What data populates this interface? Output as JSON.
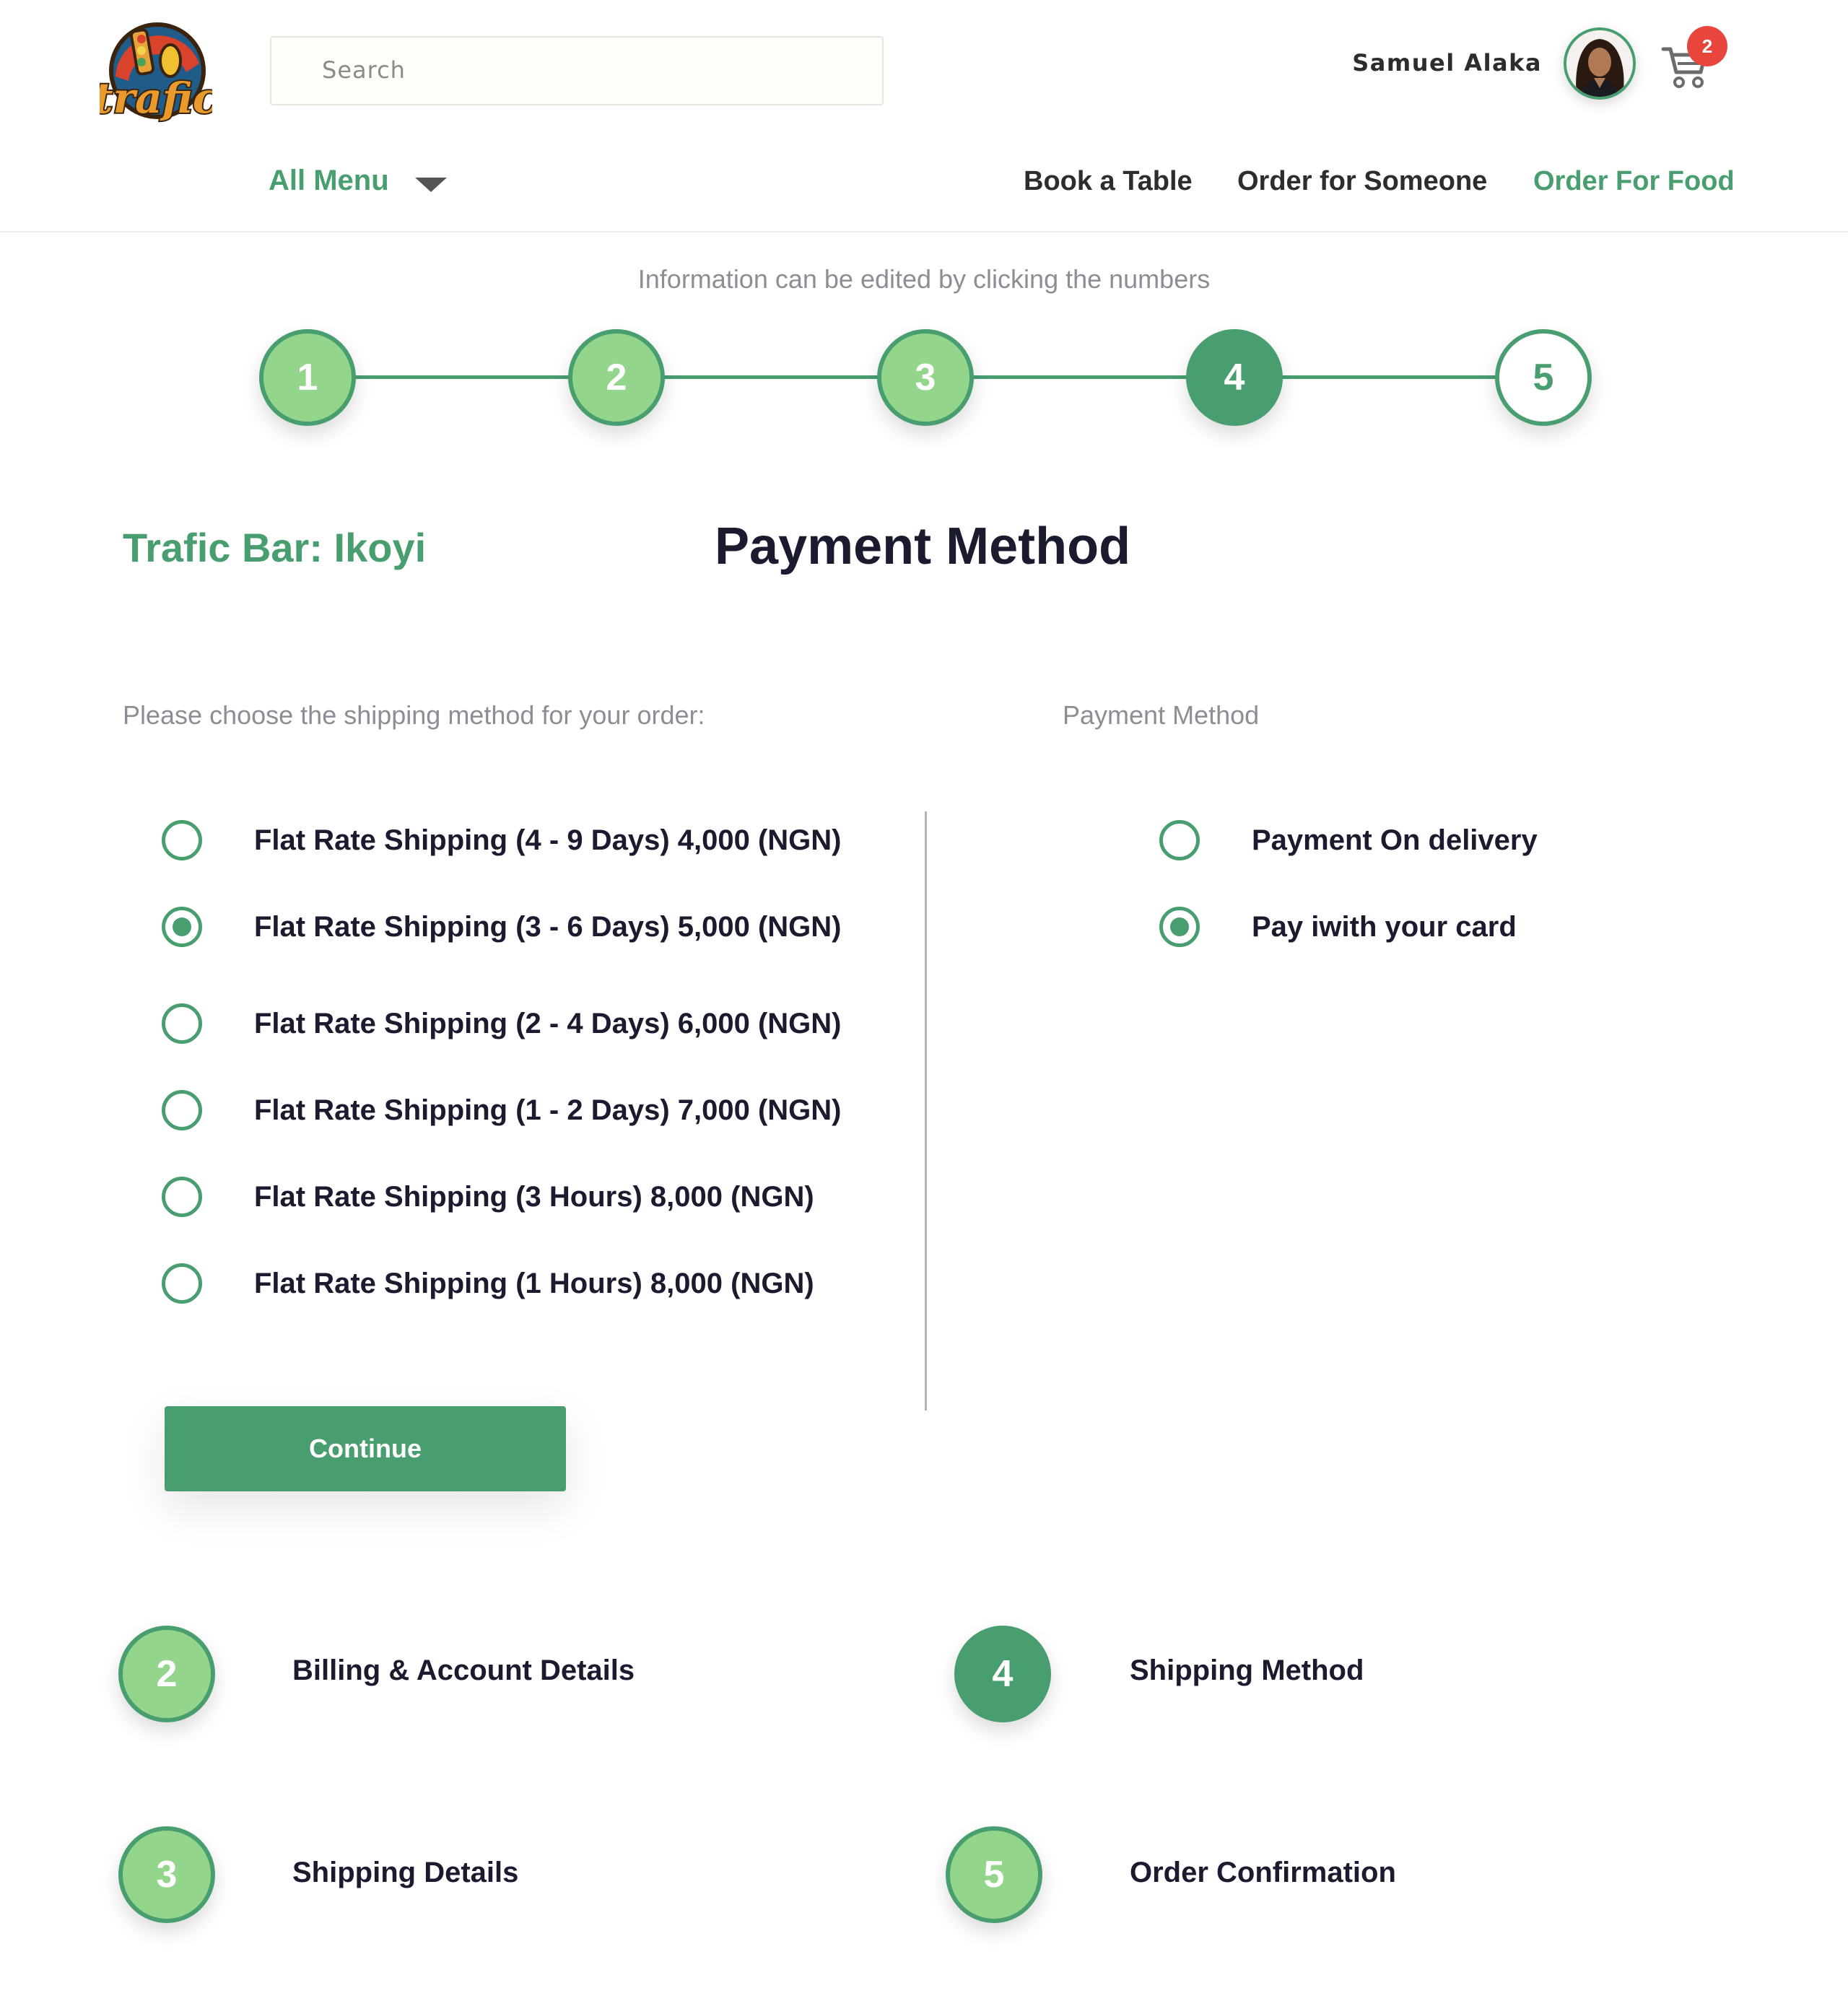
{
  "header": {
    "logo_text": "trafic",
    "search_placeholder": "Search",
    "user_name": "Samuel Alaka",
    "cart_count": "2"
  },
  "nav": {
    "all_menu": "All Menu",
    "links": [
      "Book a Table",
      "Order for Someone",
      "Order For Food"
    ],
    "active_link": "Order For Food"
  },
  "stepper": {
    "hint": "Information can be edited by clicking the numbers",
    "steps": [
      "1",
      "2",
      "3",
      "4",
      "5"
    ],
    "current_step": 4
  },
  "location": "Trafic Bar: Ikoyi",
  "page_title": "Payment Method",
  "shipping": {
    "prompt": "Please choose the shipping method for your order:",
    "options": [
      "Flat Rate Shipping (4 - 9 Days)  4,000 (NGN)",
      "Flat Rate Shipping (3 - 6 Days)  5,000 (NGN)",
      "Flat Rate Shipping (2 - 4 Days)  6,000 (NGN)",
      "Flat Rate Shipping (1 - 2 Days)  7,000 (NGN)",
      "Flat Rate Shipping (3 Hours)  8,000 (NGN)",
      "Flat Rate Shipping (1 Hours)  8,000 (NGN)"
    ],
    "selected_index": 1
  },
  "payment": {
    "heading": "Payment Method",
    "options": [
      "Payment On delivery",
      "Pay iwith your card"
    ],
    "selected_index": 1
  },
  "continue_label": "Continue",
  "summary": [
    {
      "number": "2",
      "label": "Billing & Account Details"
    },
    {
      "number": "4",
      "label": "Shipping Method"
    },
    {
      "number": "3",
      "label": "Shipping Details"
    },
    {
      "number": "5",
      "label": "Order Confirmation"
    }
  ],
  "colors": {
    "brand_green": "#489e6f",
    "light_green": "#94d58c",
    "badge_red": "#e8453c"
  }
}
